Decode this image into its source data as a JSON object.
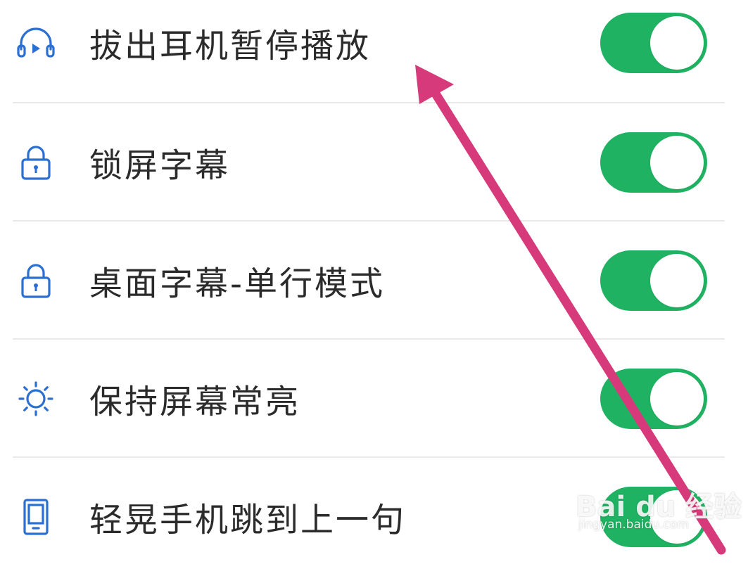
{
  "settings": [
    {
      "label": "拔出耳机暂停播放",
      "icon": "headphones-play-icon",
      "enabled": true
    },
    {
      "label": "锁屏字幕",
      "icon": "lock-icon",
      "enabled": true
    },
    {
      "label": "桌面字幕-单行模式",
      "icon": "lock-icon",
      "enabled": true
    },
    {
      "label": "保持屏幕常亮",
      "icon": "sun-icon",
      "enabled": true
    },
    {
      "label": "轻晃手机跳到上一句",
      "icon": "phone-icon",
      "enabled": true
    }
  ],
  "colors": {
    "toggle_on": "#1fb262",
    "icon": "#2a6fd1",
    "arrow": "#d63a7b"
  },
  "watermark": {
    "brand": "Bai du 经验",
    "url": "jingyan.baidu.com"
  }
}
